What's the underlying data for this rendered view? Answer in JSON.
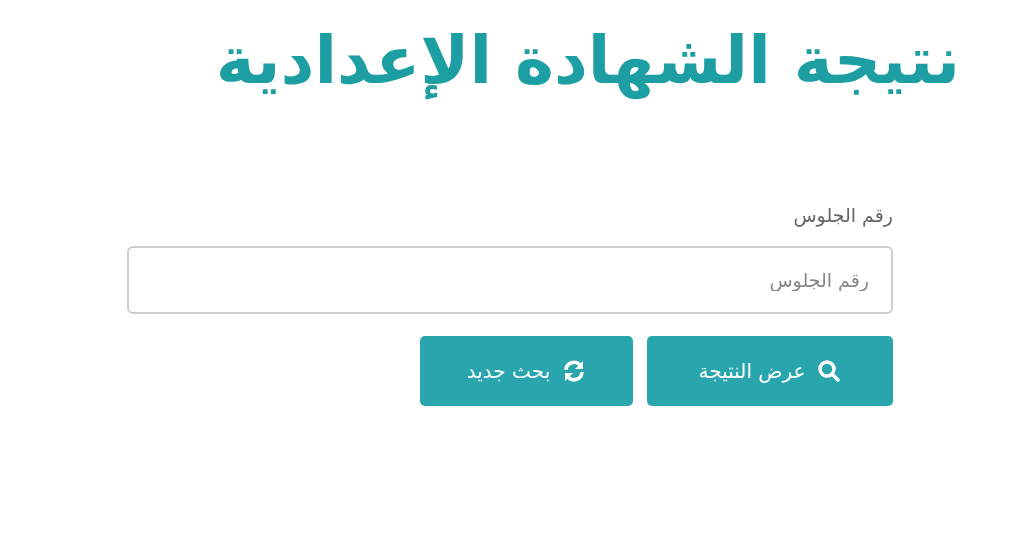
{
  "title": "نتيجة الشهادة الإعدادية",
  "form": {
    "label": "رقم الجلوس",
    "field": {
      "placeholder": "رقم الجلوس"
    },
    "buttons": [
      {
        "kind": "search",
        "label": "عرض النتيجة"
      },
      {
        "kind": "refresh",
        "label": "بحث جديد"
      }
    ]
  }
}
